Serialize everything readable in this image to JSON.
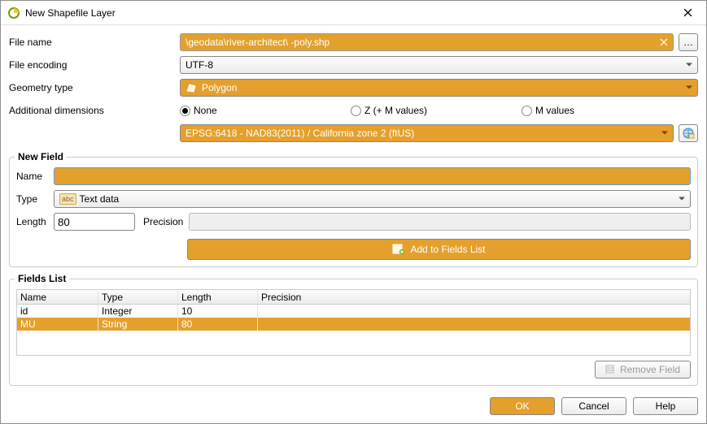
{
  "window": {
    "title": "New Shapefile Layer"
  },
  "form": {
    "filename_label": "File name",
    "filename_value": "\\geodata\\river-architect\\         -poly.shp",
    "browse_label": "…",
    "encoding_label": "File encoding",
    "encoding_value": "UTF-8",
    "geometry_label": "Geometry type",
    "geometry_value": "Polygon",
    "dimensions_label": "Additional dimensions",
    "radio_none": "None",
    "radio_z": "Z (+ M values)",
    "radio_m": "M values",
    "crs_value": "EPSG:6418 - NAD83(2011) / California zone 2 (ftUS)"
  },
  "newfield": {
    "group_title": "New Field",
    "name_label": "Name",
    "name_value": "",
    "type_label": "Type",
    "type_value": "Text data",
    "length_label": "Length",
    "length_value": "80",
    "precision_label": "Precision",
    "add_button": "Add to Fields List"
  },
  "fieldslist": {
    "group_title": "Fields List",
    "col_name": "Name",
    "col_type": "Type",
    "col_length": "Length",
    "col_precision": "Precision",
    "rows": [
      {
        "name": "id",
        "type": "Integer",
        "length": "10",
        "precision": ""
      },
      {
        "name": "MU",
        "type": "String",
        "length": "80",
        "precision": ""
      }
    ],
    "remove_label": "Remove Field"
  },
  "footer": {
    "ok": "OK",
    "cancel": "Cancel",
    "help": "Help"
  }
}
